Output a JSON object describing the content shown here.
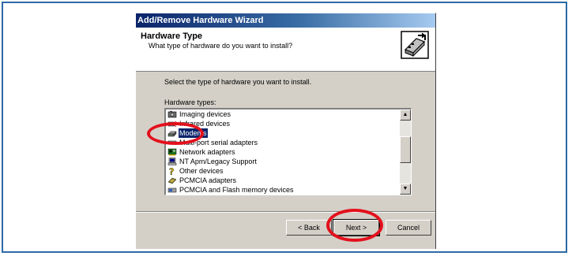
{
  "window": {
    "title": "Add/Remove Hardware Wizard"
  },
  "header": {
    "title": "Hardware Type",
    "subtitle": "What type of hardware do you want to install?"
  },
  "instruction": "Select the type of hardware you want to install.",
  "list": {
    "label": "Hardware types:",
    "items": [
      {
        "label": "Imaging devices",
        "icon": "camera-icon",
        "selected": false
      },
      {
        "label": "Infrared devices",
        "icon": "infrared-icon",
        "selected": false
      },
      {
        "label": "Modems",
        "icon": "modem-icon",
        "selected": true
      },
      {
        "label": "Multi-port serial adapters",
        "icon": "serial-port-icon",
        "selected": false
      },
      {
        "label": "Network adapters",
        "icon": "network-adapter-icon",
        "selected": false
      },
      {
        "label": "NT Apm/Legacy Support",
        "icon": "computer-icon",
        "selected": false
      },
      {
        "label": "Other devices",
        "icon": "question-mark-icon",
        "selected": false
      },
      {
        "label": "PCMCIA adapters",
        "icon": "pcmcia-card-icon",
        "selected": false
      },
      {
        "label": "PCMCIA and Flash memory devices",
        "icon": "flash-card-icon",
        "selected": false
      }
    ]
  },
  "buttons": {
    "back": "< Back",
    "next": "Next >",
    "cancel": "Cancel"
  },
  "colors": {
    "titlebar_start": "#0a246a",
    "titlebar_end": "#a6caf0",
    "dialog_face": "#d4d0c8",
    "selection": "#0a246a",
    "highlight_ring": "#e3101c",
    "frame_border": "#2c6aa6"
  }
}
